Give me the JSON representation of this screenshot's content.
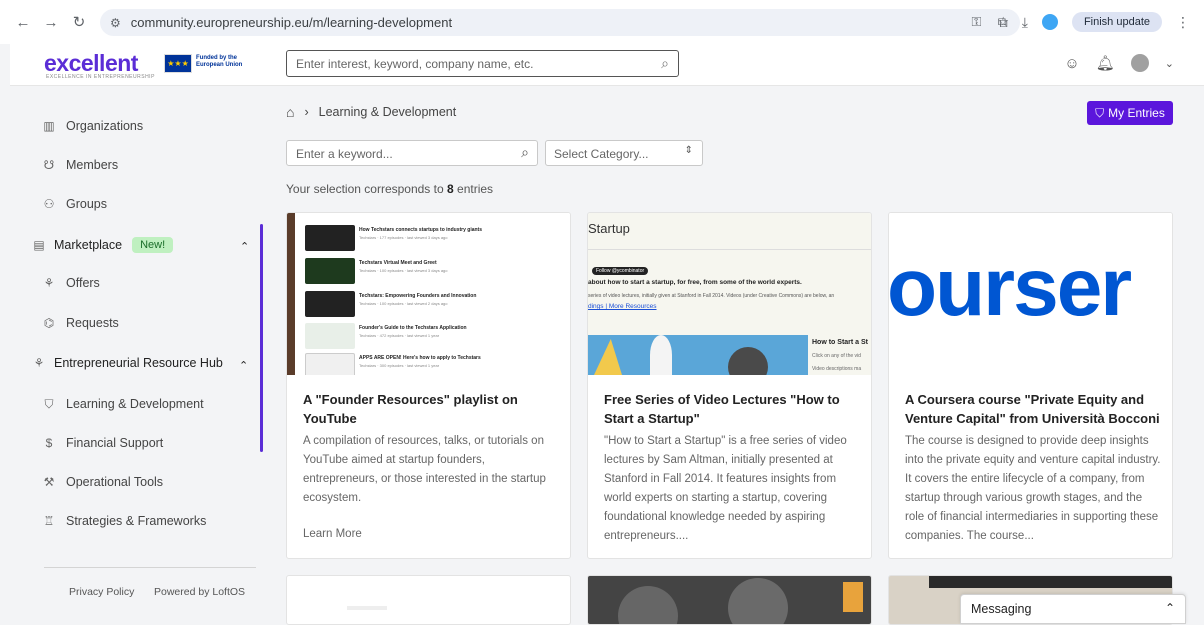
{
  "browser": {
    "url": "community.europreneurship.eu/m/learning-development",
    "finish_update": "Finish update"
  },
  "header": {
    "logo_text": "excellent",
    "logo_sub": "EXCELLENCE IN ENTREPRENEURSHIP",
    "eu_text": "Funded by the European Union",
    "search_placeholder": "Enter interest, keyword, company name, etc."
  },
  "sidebar": {
    "items": [
      {
        "label": "Organizations",
        "icon": "building-icon"
      },
      {
        "label": "Members",
        "icon": "members-icon"
      },
      {
        "label": "Groups",
        "icon": "groups-icon"
      }
    ],
    "marketplace": {
      "label": "Marketplace",
      "badge": "New!"
    },
    "market_items": [
      {
        "label": "Offers",
        "icon": "offers-icon"
      },
      {
        "label": "Requests",
        "icon": "requests-icon"
      }
    ],
    "hub": {
      "label": "Entrepreneurial Resource Hub"
    },
    "hub_items": [
      {
        "label": "Learning & Development",
        "icon": "graduation-icon"
      },
      {
        "label": "Financial Support",
        "icon": "dollar-icon"
      },
      {
        "label": "Operational Tools",
        "icon": "tool-icon"
      },
      {
        "label": "Strategies & Frameworks",
        "icon": "strategy-icon"
      }
    ],
    "footer": {
      "privacy": "Privacy Policy",
      "powered": "Powered by LoftOS"
    }
  },
  "main": {
    "breadcrumb_current": "Learning & Development",
    "my_entries": "My Entries",
    "keyword_placeholder": "Enter a keyword...",
    "category_placeholder": "Select Category...",
    "selection_prefix": "Your selection corresponds to",
    "selection_count": "8",
    "selection_suffix": "entries",
    "cards": [
      {
        "title": "A \"Founder Resources\" playlist on YouTube",
        "desc": "A compilation of resources, talks, or tutorials on YouTube aimed at startup founders, entrepreneurs, or those interested in the startup ecosystem.",
        "link": "Learn More"
      },
      {
        "title": "Free Series of Video Lectures \"How to Start a Startup\"",
        "desc": "\"How to Start a Startup\" is a free series of video lectures by Sam Altman, initially presented at Stanford in Fall 2014. It features insights from world experts on starting a startup, covering foundational knowledge needed by aspiring entrepreneurs....",
        "thumb_title": "Startup",
        "thumb_follow": "Follow @ycombinator",
        "thumb_line1": "about how to start a startup, for free, from some of the world experts.",
        "thumb_line2": "series of video lectures, initially given at Stanford in Fall 2014. Videos (under Creative Commons) are below, an",
        "thumb_links": "dings | More Resources",
        "thumb_side": "How to Start a St",
        "thumb_side2": "Click on any of the vid",
        "thumb_side3": "Video descriptions ma"
      },
      {
        "title": "A Coursera course \"Private Equity and Venture Capital\" from Università Bocconi",
        "desc": "The course is designed to provide deep insights into the private equity and venture capital industry. It covers the entire lifecycle of a company, from startup through various growth stages, and the role of financial intermediaries in supporting these companies. The course...",
        "thumb_word": "ourser"
      }
    ],
    "playlist": [
      {
        "title": "How Techstars connects startups to industry giants",
        "meta": "Techstars · 177 episodes · last viewed 3 days ago"
      },
      {
        "title": "Techstars Virtual Meet and Greet",
        "meta": "Techstars · 100 episodes · last viewed 3 days ago"
      },
      {
        "title": "Techstars: Empowering Founders and Innovation",
        "meta": "Techstars · 100 episodes · last viewed 2 days ago"
      },
      {
        "title": "Founder's Guide to the Techstars Application",
        "meta": "Techstars · 472 episodes · last viewed 1 year"
      },
      {
        "title": "APPS ARE OPEN! Here's how to apply to Techstars",
        "meta": "Techstars · 300 episodes · last viewed 1 year"
      }
    ]
  },
  "messaging": {
    "label": "Messaging"
  }
}
